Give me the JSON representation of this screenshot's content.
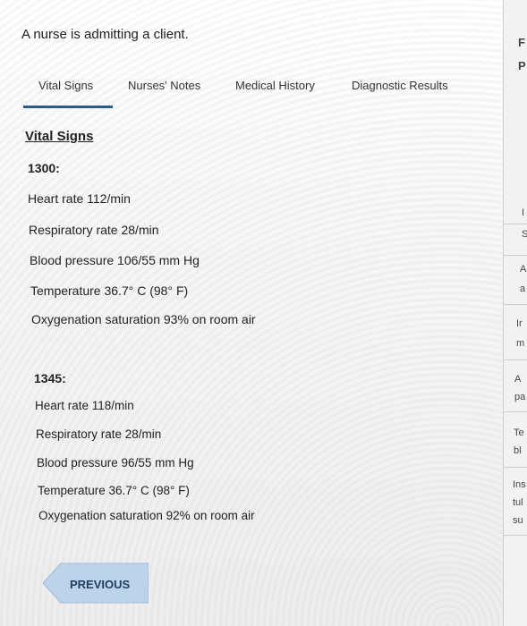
{
  "header": {
    "prompt": "A nurse is admitting a client."
  },
  "tabs": [
    {
      "label": "Vital Signs"
    },
    {
      "label": "Nurses' Notes"
    },
    {
      "label": "Medical History"
    },
    {
      "label": "Diagnostic Results"
    }
  ],
  "active_tab": "Vital Signs",
  "content": {
    "section_title": "Vital Signs",
    "readings": [
      {
        "time": "1300:",
        "items": [
          "Heart rate 112/min",
          "Respiratory rate 28/min",
          "Blood pressure 106/55 mm Hg",
          "Temperature 36.7° C (98° F)",
          "Oxygenation saturation 93% on room air"
        ]
      },
      {
        "time": "1345:",
        "items": [
          "Heart rate 118/min",
          "Respiratory rate 28/min",
          "Blood pressure 96/55 mm Hg",
          "Temperature 36.7° C (98° F)",
          "Oxygenation saturation 92% on room air"
        ]
      }
    ]
  },
  "navigation": {
    "previous_label": "PREVIOUS"
  },
  "right_panel_fragments": [
    "F",
    "P",
    "I",
    "S",
    "A",
    "a",
    "Ir",
    "m",
    "A",
    "pa",
    "Te",
    "bl",
    "Ins",
    "tul",
    "su"
  ],
  "colors": {
    "tab_underline": "#2a5d8a",
    "prev_button": "#bcd3ea",
    "prev_text": "#1f3e63"
  }
}
